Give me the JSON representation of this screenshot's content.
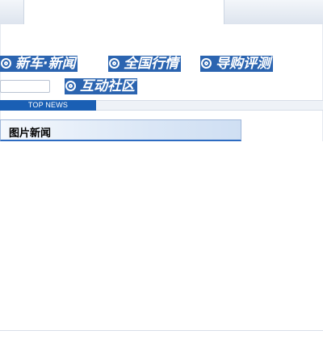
{
  "nav": {
    "items": [
      {
        "label": "新车·新闻"
      },
      {
        "label": "全国行情"
      },
      {
        "label": "导购评测"
      },
      {
        "label": "互动社区"
      }
    ]
  },
  "search": {
    "value": "",
    "placeholder": ""
  },
  "top_news": {
    "label": "TOP NEWS"
  },
  "section": {
    "title": "图片新闻"
  },
  "colors": {
    "nav_bg": "#2b64b0",
    "topnews_bg": "#1a5fb4",
    "header_border": "#2d6bc1"
  },
  "icons": {
    "nav_bullet": "swirl-icon"
  }
}
